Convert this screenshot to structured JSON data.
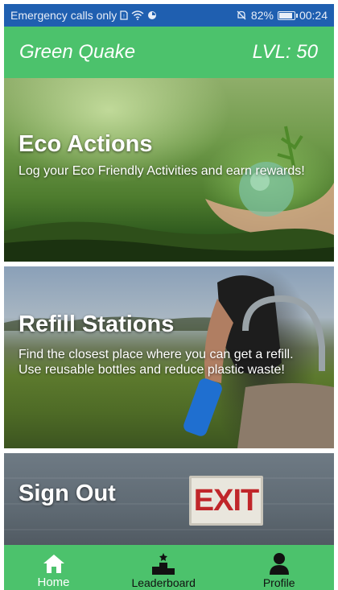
{
  "status_bar": {
    "carrier_text": "Emergency calls only",
    "battery_percent": "82%",
    "battery_level": 0.82,
    "time": "00:24",
    "icons": [
      "sim-icon",
      "wifi-icon",
      "sync-icon",
      "mute-icon",
      "battery-icon"
    ]
  },
  "header": {
    "app_name": "Green Quake",
    "level": "LVL: 50"
  },
  "cards": [
    {
      "title": "Eco Actions",
      "description": "Log your Eco Friendly Activities and earn rewards!"
    },
    {
      "title": "Refill Stations",
      "description": "Find the closest place where you can get a refill. Use reusable bottles and reduce plastic waste!"
    },
    {
      "title": "Sign Out",
      "sign_text": "EXIT"
    }
  ],
  "bottom_nav": {
    "items": [
      {
        "label": "Home",
        "icon": "home-icon",
        "active": true
      },
      {
        "label": "Leaderboard",
        "icon": "podium-icon",
        "active": false
      },
      {
        "label": "Profile",
        "icon": "person-icon",
        "active": false
      }
    ]
  },
  "colors": {
    "primary_green": "#4cc26c",
    "status_bar_blue": "#1f5fb0"
  }
}
